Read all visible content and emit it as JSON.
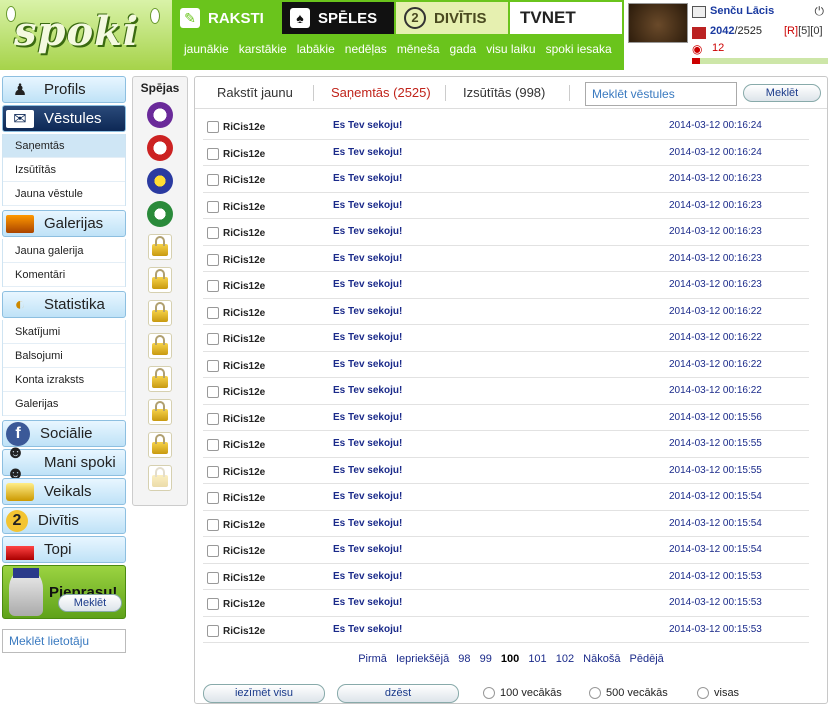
{
  "header": {
    "logo_text": "spoki",
    "tabs": [
      {
        "label": "RAKSTI"
      },
      {
        "label": "SPĒLES"
      },
      {
        "label": "DIVĪTIS"
      },
      {
        "label": "TVNET"
      }
    ],
    "sublinks": [
      "jaunākie",
      "karstākie",
      "labākie",
      "nedēļas",
      "mēneša",
      "gada",
      "visu laiku",
      "spoki iesaka"
    ],
    "user": {
      "name": "Senču Lācis",
      "score": "2042",
      "score_total": "/2525",
      "flag_r": "[R]",
      "flag_counts": "[5][0]",
      "views": "12"
    }
  },
  "sidebar": {
    "profile": "Profils",
    "messages": "Vēstules",
    "messages_sub": [
      "Saņemtās",
      "Izsūtītās",
      "Jauna vēstule"
    ],
    "galleries": "Galerijas",
    "galleries_sub": [
      "Jauna galerija",
      "Komentāri"
    ],
    "stats": "Statistika",
    "stats_sub": [
      "Skatījumi",
      "Balsojumi",
      "Konta izraksts",
      "Galerijas"
    ],
    "social": "Sociālie",
    "my_spoki": "Mani spoki",
    "shop": "Veikals",
    "divitis": "Divītis",
    "top": "Topi",
    "pieprasu": "Pieprasu!",
    "search_user_placeholder": "Meklēt lietotāju",
    "search_user_btn": "Meklēt"
  },
  "abilities": {
    "title": "Spējas"
  },
  "messages": {
    "tabs": {
      "new": "Rakstīt jaunu",
      "received": "Saņemtās (2525)",
      "sent": "Izsūtītās (998)"
    },
    "search_placeholder": "Meklēt vēstules",
    "search_btn": "Meklēt",
    "rows": [
      {
        "sender": "RiCis12e",
        "subject": "Es Tev sekoju!",
        "date": "2014-03-12 00:16:24"
      },
      {
        "sender": "RiCis12e",
        "subject": "Es Tev sekoju!",
        "date": "2014-03-12 00:16:24"
      },
      {
        "sender": "RiCis12e",
        "subject": "Es Tev sekoju!",
        "date": "2014-03-12 00:16:23"
      },
      {
        "sender": "RiCis12e",
        "subject": "Es Tev sekoju!",
        "date": "2014-03-12 00:16:23"
      },
      {
        "sender": "RiCis12e",
        "subject": "Es Tev sekoju!",
        "date": "2014-03-12 00:16:23"
      },
      {
        "sender": "RiCis12e",
        "subject": "Es Tev sekoju!",
        "date": "2014-03-12 00:16:23"
      },
      {
        "sender": "RiCis12e",
        "subject": "Es Tev sekoju!",
        "date": "2014-03-12 00:16:23"
      },
      {
        "sender": "RiCis12e",
        "subject": "Es Tev sekoju!",
        "date": "2014-03-12 00:16:22"
      },
      {
        "sender": "RiCis12e",
        "subject": "Es Tev sekoju!",
        "date": "2014-03-12 00:16:22"
      },
      {
        "sender": "RiCis12e",
        "subject": "Es Tev sekoju!",
        "date": "2014-03-12 00:16:22"
      },
      {
        "sender": "RiCis12e",
        "subject": "Es Tev sekoju!",
        "date": "2014-03-12 00:16:22"
      },
      {
        "sender": "RiCis12e",
        "subject": "Es Tev sekoju!",
        "date": "2014-03-12 00:15:56"
      },
      {
        "sender": "RiCis12e",
        "subject": "Es Tev sekoju!",
        "date": "2014-03-12 00:15:55"
      },
      {
        "sender": "RiCis12e",
        "subject": "Es Tev sekoju!",
        "date": "2014-03-12 00:15:55"
      },
      {
        "sender": "RiCis12e",
        "subject": "Es Tev sekoju!",
        "date": "2014-03-12 00:15:54"
      },
      {
        "sender": "RiCis12e",
        "subject": "Es Tev sekoju!",
        "date": "2014-03-12 00:15:54"
      },
      {
        "sender": "RiCis12e",
        "subject": "Es Tev sekoju!",
        "date": "2014-03-12 00:15:54"
      },
      {
        "sender": "RiCis12e",
        "subject": "Es Tev sekoju!",
        "date": "2014-03-12 00:15:53"
      },
      {
        "sender": "RiCis12e",
        "subject": "Es Tev sekoju!",
        "date": "2014-03-12 00:15:53"
      },
      {
        "sender": "RiCis12e",
        "subject": "Es Tev sekoju!",
        "date": "2014-03-12 00:15:53"
      }
    ],
    "pager": {
      "first": "Pirmā",
      "prev": "Iepriekšējā",
      "pages": [
        "98",
        "99",
        "100",
        "101",
        "102"
      ],
      "current": "100",
      "next": "Nākošā",
      "last": "Pēdējā"
    },
    "select_all": "iezīmēt visu",
    "delete": "dzēst",
    "older100": "100 vecākās",
    "older500": "500 vecākās",
    "all": "visas"
  }
}
